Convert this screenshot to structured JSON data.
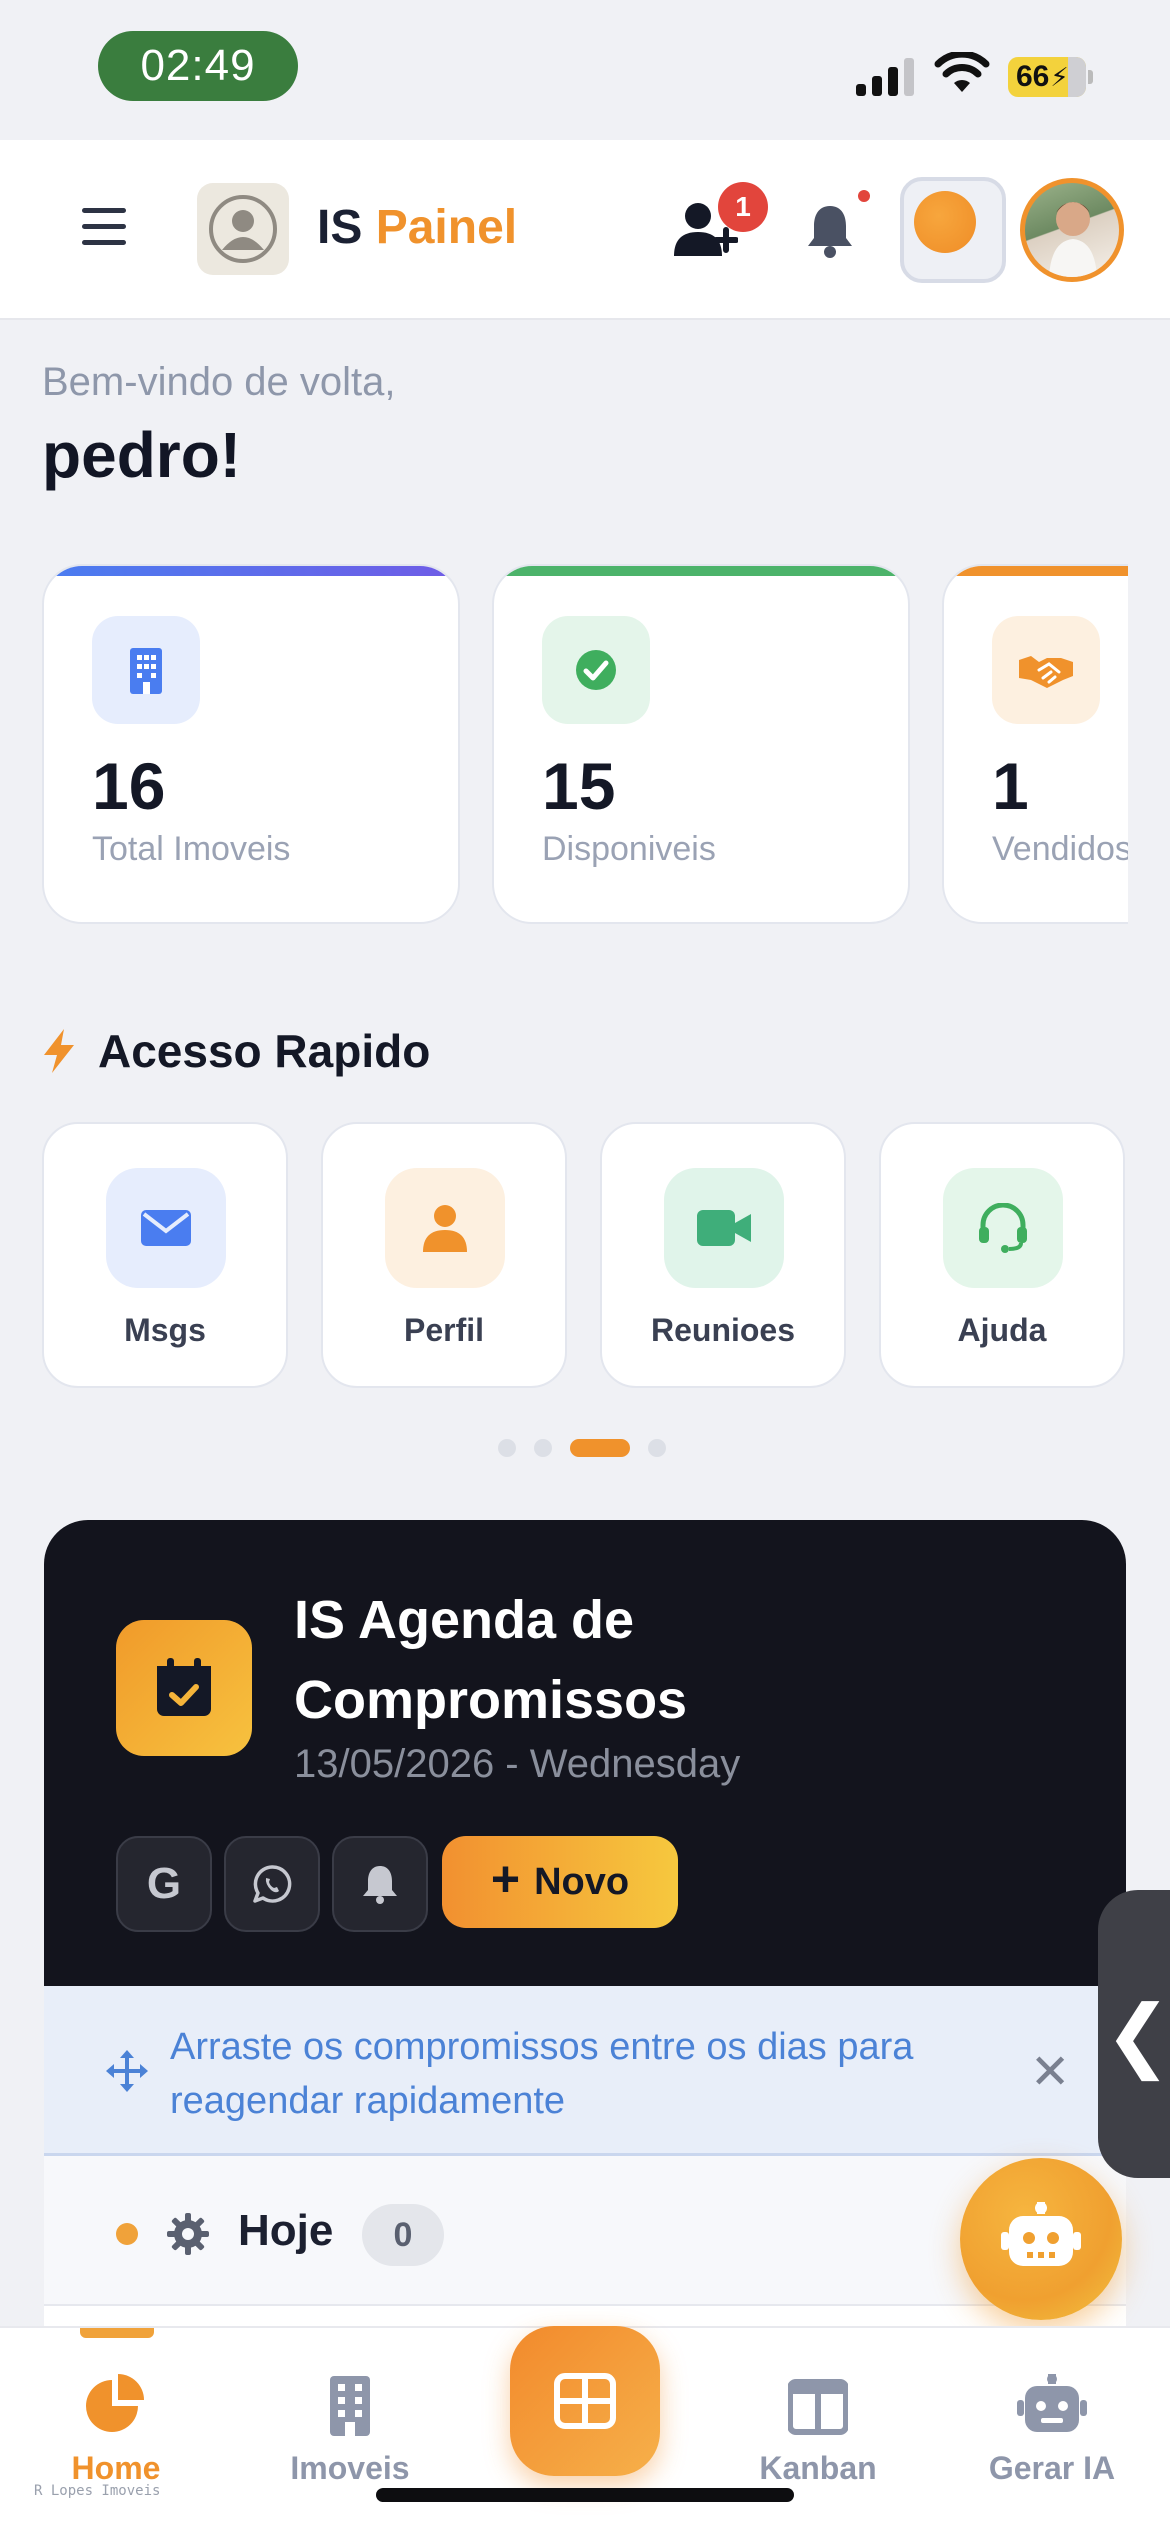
{
  "status_bar": {
    "time": "02:49",
    "battery": "66"
  },
  "header": {
    "brand_prefix": "IS",
    "brand_suffix": "Painel",
    "friend_request_count": "1"
  },
  "greeting": {
    "subtitle": "Bem-vindo de volta,",
    "name": "pedro!"
  },
  "stats": [
    {
      "value": "16",
      "label": "Total Imoveis",
      "icon": "building-icon",
      "color": "#5b6fe6"
    },
    {
      "value": "15",
      "label": "Disponiveis",
      "icon": "check-circle-icon",
      "color": "#4cb36a"
    },
    {
      "value": "1",
      "label": "Vendidos",
      "icon": "handshake-icon",
      "color": "#f0922c"
    }
  ],
  "quick_access": {
    "title": "Acesso Rapido",
    "items": [
      {
        "label": "Msgs",
        "icon": "mail-icon"
      },
      {
        "label": "Perfil",
        "icon": "user-icon"
      },
      {
        "label": "Reunioes",
        "icon": "video-icon"
      },
      {
        "label": "Ajuda",
        "icon": "headset-icon"
      }
    ],
    "pager": {
      "pages": 4,
      "active_page": 3
    }
  },
  "agenda": {
    "title": "IS Agenda de Compromissos",
    "date": "13/05/2026 - Wednesday",
    "buttons": {
      "google": "G",
      "new_label": "Novo"
    },
    "hint": "Arraste os compromissos entre os dias para reagendar rapidamente",
    "today": {
      "label": "Hoje",
      "count": "0"
    }
  },
  "bottom_nav": {
    "items": [
      {
        "label": "Home",
        "icon": "pie-chart-icon",
        "active": true
      },
      {
        "label": "Imoveis",
        "icon": "building-icon",
        "active": false
      },
      {
        "label": "Kanban",
        "icon": "kanban-icon",
        "active": false
      },
      {
        "label": "Gerar IA",
        "icon": "robot-icon",
        "active": false
      }
    ],
    "center_icon": "grid-icon"
  },
  "watermark": "R Lopes Imoveis",
  "colors": {
    "accent": "#f0922c",
    "dark": "#13141d",
    "hint_blue": "#4b82d6"
  }
}
